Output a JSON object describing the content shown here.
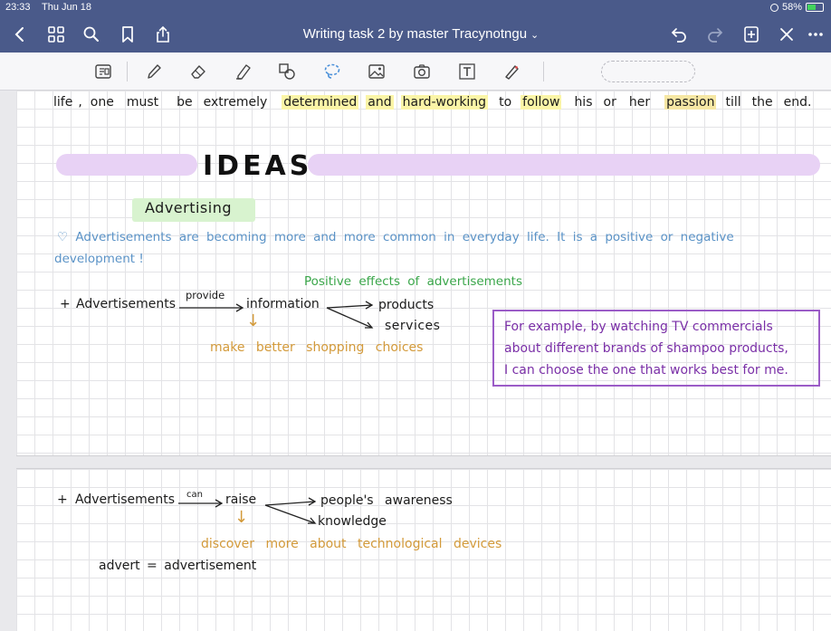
{
  "status": {
    "time": "23:33",
    "date": "Thu Jun 18",
    "battery": "58%",
    "battery_level": 0.58
  },
  "titlebar": {
    "title": "Writing task 2 by master Tracynotngu",
    "title_chevron": "⌄"
  },
  "icons": {
    "back": "chevron-left-icon",
    "grid": "grid-icon",
    "search": "search-icon",
    "bookmark": "bookmark-icon",
    "share": "share-icon",
    "undo": "undo-icon",
    "redo": "redo-icon",
    "add_page": "add-page-icon",
    "close": "close-icon",
    "more": "more-icon"
  },
  "toolbar": {
    "tools": [
      "reader-mode-icon",
      "pen-icon",
      "eraser-icon",
      "highlighter-icon",
      "shapes-icon",
      "lasso-icon",
      "image-icon",
      "camera-icon",
      "text-icon",
      "laser-pointer-icon"
    ]
  },
  "page1": {
    "line1": [
      "life",
      ",",
      "one",
      "must",
      "be",
      "extremely",
      "determined",
      "and",
      "hard-working",
      "to",
      "follow",
      "his",
      "or",
      "her",
      "passion",
      "till",
      "the",
      "end."
    ],
    "ideas_heading": "IDEAS",
    "advertising_label": "Advertising",
    "question_line1": "♡ Advertisements are becoming more and more common in everyday life. It is a positive or negative",
    "question_line2": "development !",
    "positive_effects": "Positive effects of advertisements",
    "plus": "+",
    "subject": "Advertisements",
    "verb_label": "provide",
    "object": "information",
    "branch1": "products",
    "branch2": "services",
    "down_arrow": "↓",
    "result": "make better shopping choices",
    "example_lines": [
      "For example, by watching TV commercials",
      "about different brands of shampoo products,",
      "I can choose the one that works best for me."
    ]
  },
  "page2": {
    "plus": "+",
    "subject": "Advertisements",
    "verb_label": "can",
    "object": "raise",
    "branch1": "people's awareness",
    "branch2": "knowledge",
    "down_arrow": "↓",
    "result": "discover more about technological devices",
    "note": "advert = advertisement"
  }
}
